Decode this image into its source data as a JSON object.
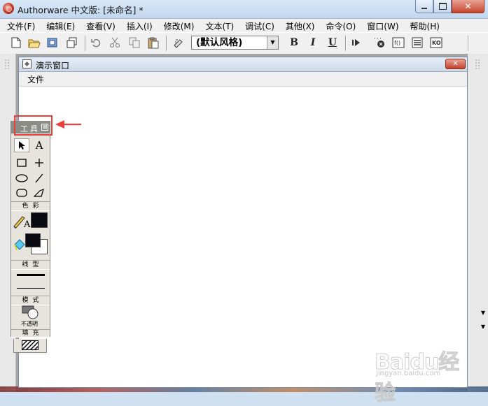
{
  "window": {
    "title": "Authorware 中文版: [未命名] *",
    "close_glyph": "✕"
  },
  "menubar": {
    "items": [
      "文件(F)",
      "编辑(E)",
      "查看(V)",
      "插入(I)",
      "修改(M)",
      "文本(T)",
      "调试(C)",
      "其他(X)",
      "命令(O)",
      "窗口(W)",
      "帮助(H)"
    ]
  },
  "toolbar": {
    "style_select_value": "(默认风格)",
    "bold_label": "B",
    "italic_label": "I",
    "underline_label": "U"
  },
  "presentation_window": {
    "title": "演示窗口",
    "menu_file": "文件",
    "close_glyph": "✕"
  },
  "tools_palette": {
    "title": "工具",
    "close_glyph": "⊠",
    "text_tool_glyph": "A",
    "section_color": "色彩",
    "section_line": "线型",
    "section_mode": "模式",
    "mode_value": "不透明",
    "section_fill": "填充"
  },
  "watermark": {
    "brand": "Baidu经验",
    "sub": "jingyan.baidu.com"
  },
  "colors": {
    "annotation_red": "#e8413d",
    "palette_header": "#8c8c86",
    "foreground_swatch": "#0a0a12"
  }
}
